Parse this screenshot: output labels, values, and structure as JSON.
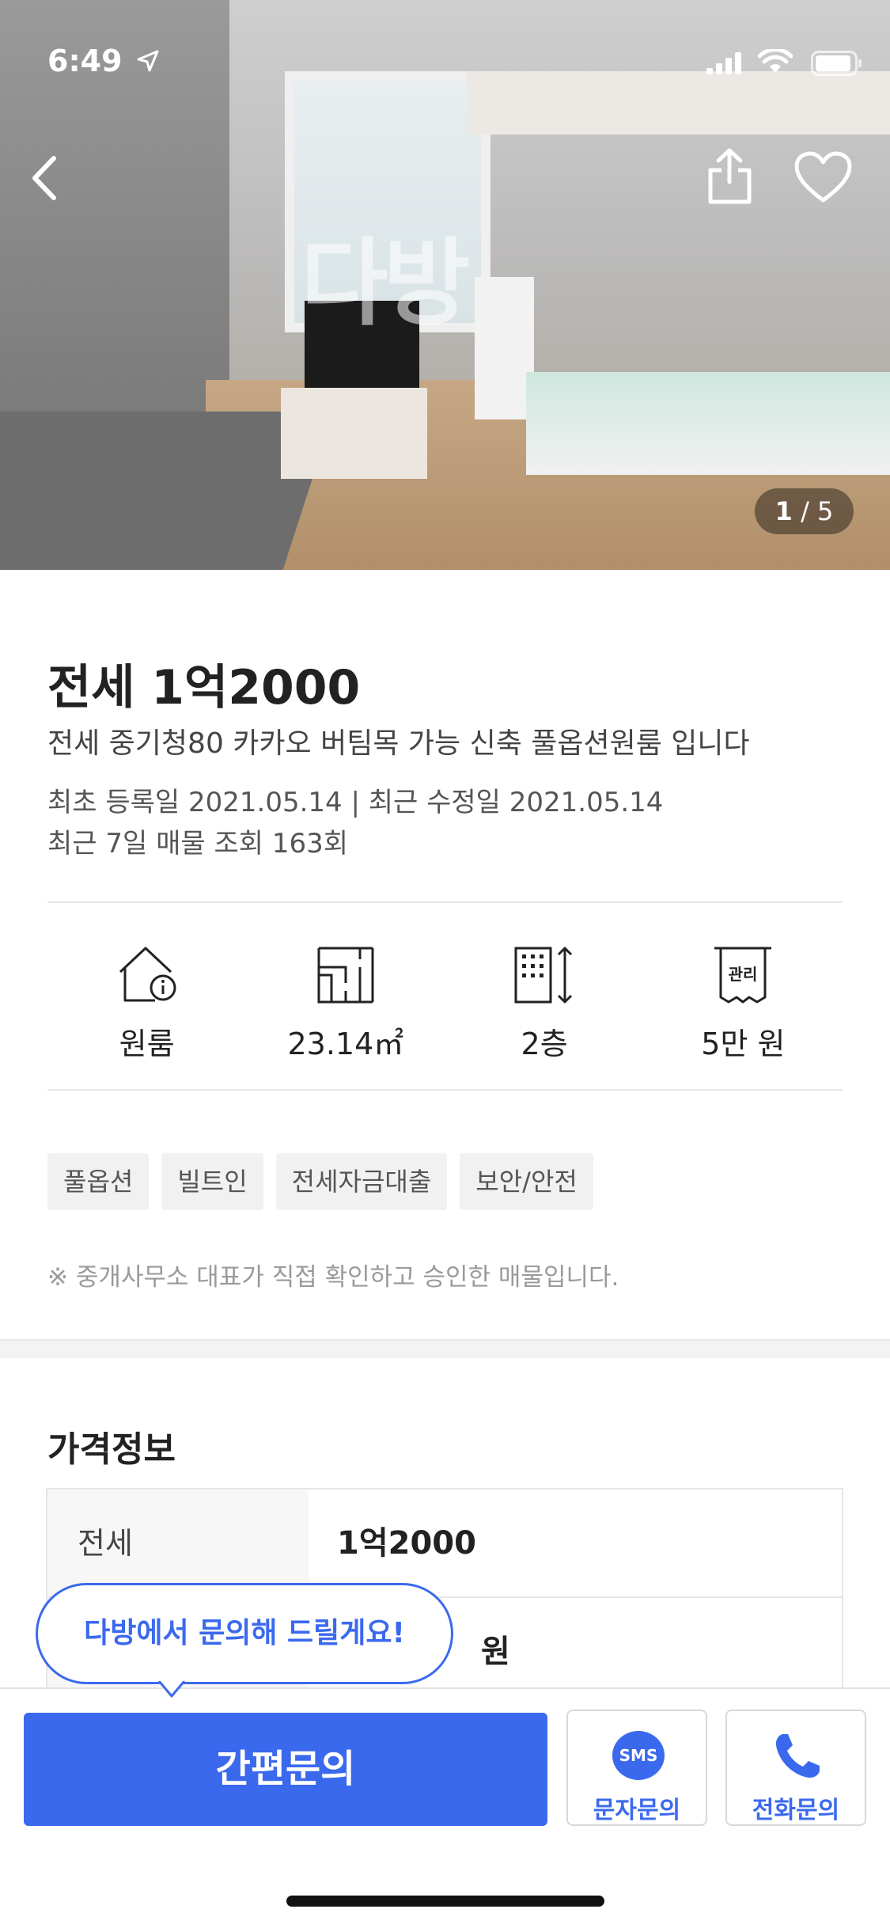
{
  "status_bar": {
    "time": "6:49"
  },
  "hero": {
    "watermark": "다방",
    "counter_current": "1",
    "counter_total": "/ 5"
  },
  "listing": {
    "price_title": "전세 1억2000",
    "description": "전세 중기청80 카카오 버팀목 가능 신축 풀옵션원룸 입니다",
    "dates_line": "최초 등록일 2021.05.14  | 최근 수정일 2021.05.14",
    "views_line": "최근 7일 매물 조회 163회"
  },
  "specs": [
    {
      "icon": "house-info-icon",
      "label": "원룸"
    },
    {
      "icon": "floorplan-icon",
      "label": "23.14㎡"
    },
    {
      "icon": "building-floor-icon",
      "label": "2층"
    },
    {
      "icon": "maintenance-fee-icon",
      "label": "5만 원",
      "icon_text": "관리"
    }
  ],
  "tags": [
    "풀옵션",
    "빌트인",
    "전세자금대출",
    "보안/안전"
  ],
  "note": "※ 중개사무소 대표가 직접 확인하고 승인한 매물입니다.",
  "price_info": {
    "title": "가격정보",
    "rows": [
      {
        "key": "전세",
        "value": "1억2000"
      },
      {
        "key": "",
        "value": "원"
      }
    ]
  },
  "bottom": {
    "bubble": "다방에서 문의해 드릴게요!",
    "inquiry_label": "간편문의",
    "sms_badge": "SMS",
    "sms_label": "문자문의",
    "call_label": "전화문의"
  },
  "colors": {
    "accent": "#3b69ee"
  }
}
